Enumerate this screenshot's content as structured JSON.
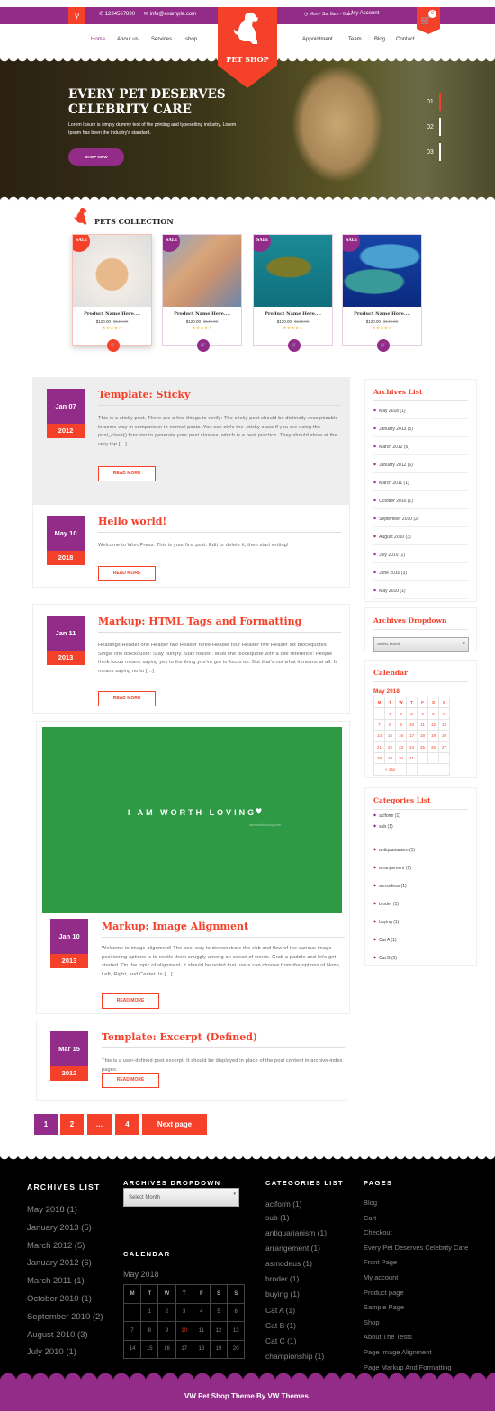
{
  "colors": {
    "purple": "#922c88",
    "orange": "#f5412a",
    "green": "#2e9a45"
  },
  "topbar": {
    "search_icon": "search-icon",
    "phone": "1234567890",
    "email": "info@example.com",
    "hours": "Mon - Sat 8am - 6pm",
    "account": "My Account",
    "cart_count": "0"
  },
  "logo": {
    "text": "PET SHOP"
  },
  "nav": {
    "left": [
      "Home",
      "About us",
      "Services",
      "shop"
    ],
    "right": [
      "Appointment",
      "Team",
      "Blog",
      "Contact"
    ],
    "active": "Home"
  },
  "hero": {
    "title": "EVERY PET DESERVES CELEBRITY CARE",
    "text": "Lorem Ipsum is simply dummy text of the printing and typesetting industry. Lorem Ipsum has been the industry's standard.",
    "button": "SHOP NOW",
    "slides": [
      "01",
      "02",
      "03"
    ],
    "active_slide": "01"
  },
  "collection": {
    "title": "PETS COLLECTION",
    "products": [
      {
        "sale": "SALE",
        "name": "Product Name Here....",
        "price": "$120.00",
        "old_price": "$149.99",
        "rating": 4
      },
      {
        "sale": "SALE",
        "name": "Product Name Here....",
        "price": "$120.00",
        "old_price": "$149.99",
        "rating": 4
      },
      {
        "sale": "SALE",
        "name": "Product Name Here....",
        "price": "$120.00",
        "old_price": "$149.99",
        "rating": 4
      },
      {
        "sale": "SALE",
        "name": "Product Name Here....",
        "price": "$120.00",
        "old_price": "$149.99",
        "rating": 4
      }
    ]
  },
  "posts": [
    {
      "day": "Jan 07",
      "year": "2012",
      "title": "Template: Sticky",
      "text": "This is a sticky post. There are a few things to verify: The sticky post should be distinctly recognizable in some way in comparison to normal posts. You can style the .sticky class if you are using the post_class() function to generate your post classes, which is a best practice. They should show at the very top […]",
      "button": "READ MORE"
    },
    {
      "day": "May 10",
      "year": "2018",
      "title": "Hello world!",
      "text": "Welcome to WordPress. This is your first post. Edit or delete it, then start writing!",
      "button": "READ MORE"
    },
    {
      "day": "Jan 11",
      "year": "2013",
      "title": "Markup: HTML Tags and Formatting",
      "text": "Headings Header one Header two Header three Header four Header five Header six Blockquotes Single line blockquote: Stay hungry. Stay foolish. Multi line blockquote with a cite reference: People think focus means saying yes to the thing you've got to focus on. But that's not what it means at all. It means saying no to […]",
      "button": "READ MORE"
    },
    {
      "image_text": "I AM WORTH LOVING",
      "image_sub": "iamworthloving.com",
      "day": "Jan 10",
      "year": "2013",
      "title": "Markup: Image Alignment",
      "text": "Welcome to image alignment! The best way to demonstrate the ebb and flow of the various image positioning options is to nestle them snuggly among an ocean of words. Grab a paddle and let's get started. On the topic of alignment, it should be noted that users can choose from the options of None, Left, Right, and Center. In […]",
      "button": "READ MORE"
    },
    {
      "day": "Mar 15",
      "year": "2012",
      "title": "Template: Excerpt (Defined)",
      "text": "This is a user-defined post excerpt. It should be displayed in place of the post content in archive-index pages.",
      "button": "READ MORE"
    }
  ],
  "pagination": [
    "1",
    "2",
    "…",
    "4",
    "Next page"
  ],
  "sidebar": {
    "archives_title": "Archives List",
    "archives": [
      "May 2018 (1)",
      "January 2013 (5)",
      "March 2012 (5)",
      "January 2012 (6)",
      "March 2011 (1)",
      "October 2010 (1)",
      "September 2010 (2)",
      "August 2010 (3)",
      "July 2010 (1)",
      "June 2010 (3)",
      "May 2010 (1)"
    ],
    "dropdown_title": "Archives Dropdown",
    "dropdown_value": "Select Month",
    "calendar_title": "Calendar",
    "calendar_month": "May 2018",
    "calendar_days": [
      "M",
      "T",
      "W",
      "T",
      "F",
      "S",
      "S"
    ],
    "calendar_rows": [
      [
        "",
        "1",
        "2",
        "3",
        "4",
        "5",
        "6"
      ],
      [
        "7",
        "8",
        "9",
        "10",
        "11",
        "12",
        "13"
      ],
      [
        "14",
        "15",
        "16",
        "17",
        "18",
        "19",
        "20"
      ],
      [
        "21",
        "22",
        "23",
        "24",
        "25",
        "26",
        "27"
      ],
      [
        "28",
        "29",
        "30",
        "31",
        "",
        "",
        ""
      ]
    ],
    "calendar_prev": "« Jan",
    "categories_title": "Categories List",
    "categories": [
      "aciform (1)",
      "sub (1)",
      "antiquarianism (1)",
      "arrangement (1)",
      "asmodeus (1)",
      "broder (1)",
      "buying (1)",
      "Cat A (1)",
      "Cat B (1)"
    ]
  },
  "footer": {
    "archives_title": "ARCHIVES LIST",
    "archives": [
      "May 2018 (1)",
      "January 2013 (5)",
      "March 2012 (5)",
      "January 2012 (6)",
      "March 2011 (1)",
      "October 2010 (1)",
      "September 2010 (2)",
      "August 2010 (3)",
      "July 2010 (1)"
    ],
    "dropdown_title": "ARCHIVES DROPDOWN",
    "dropdown_value": "Select Month",
    "calendar_title": "CALENDAR",
    "calendar_month": "May 2018",
    "calendar_days": [
      "M",
      "T",
      "W",
      "T",
      "F",
      "S",
      "S"
    ],
    "calendar_rows": [
      [
        "",
        "1",
        "2",
        "3",
        "4",
        "5",
        "6"
      ],
      [
        "7",
        "8",
        "9",
        "10",
        "11",
        "12",
        "13"
      ],
      [
        "14",
        "15",
        "16",
        "17",
        "18",
        "19",
        "20"
      ]
    ],
    "calendar_today": "10",
    "categories_title": "CATEGORIES LIST",
    "categories": [
      "aciform (1)",
      "sub (1)",
      "antiquarianism (1)",
      "arrangement (1)",
      "asmodeus (1)",
      "broder (1)",
      "buying (1)",
      "Cat A (1)",
      "Cat B (1)",
      "Cat C (1)",
      "championship (1)"
    ],
    "pages_title": "PAGES",
    "pages": [
      "Blog",
      "Cart",
      "Checkout",
      "Every Pet Deserves Celebrity Care",
      "Front Page",
      "My account",
      "Product page",
      "Sample Page",
      "Shop",
      "About The Tests",
      "Page Image Alignment",
      "Page Markup And Formatting"
    ],
    "copyright": "VW Pet Shop Theme By VW Themes."
  }
}
